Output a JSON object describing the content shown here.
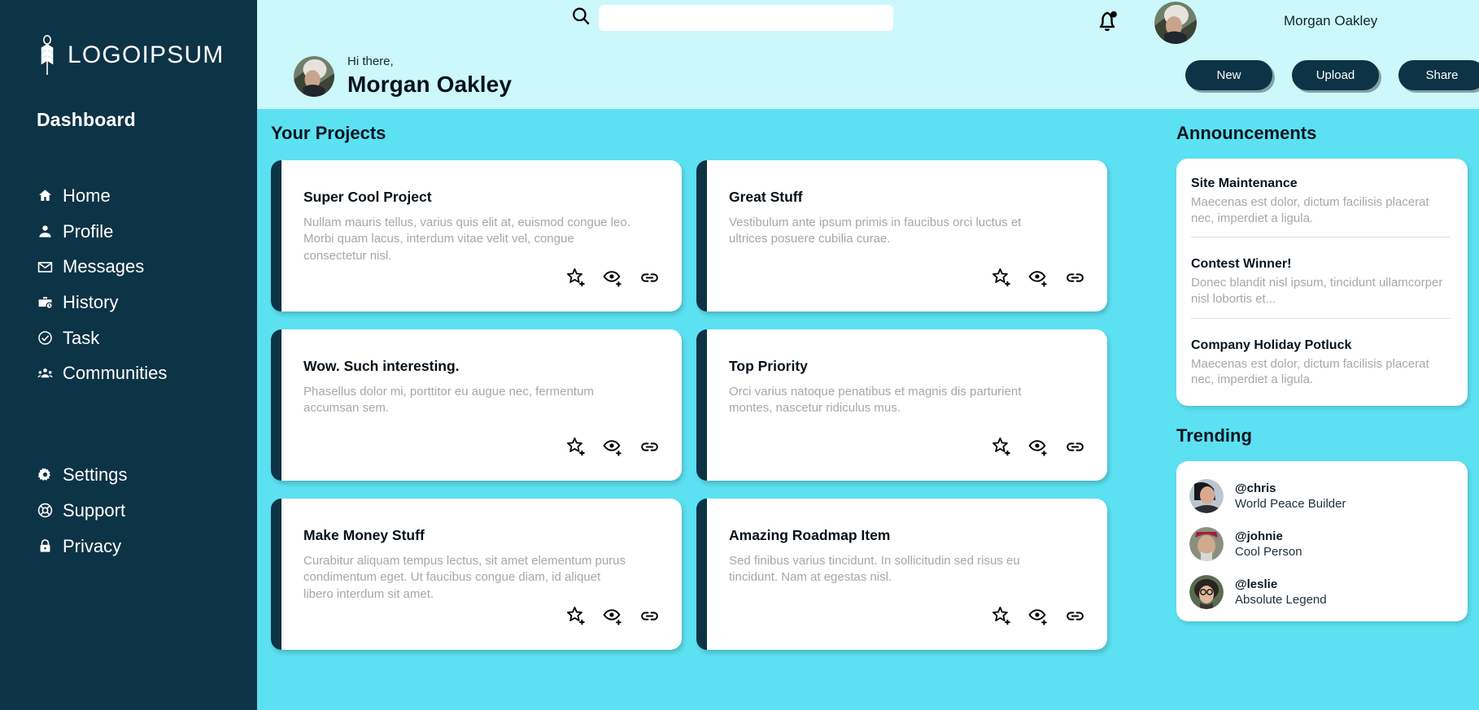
{
  "sidebar": {
    "logo_text": "LOGOIPSUM",
    "dashboard_label": "Dashboard",
    "primary_items": [
      {
        "label": "Home",
        "icon": "home-icon"
      },
      {
        "label": "Profile",
        "icon": "person-icon"
      },
      {
        "label": "Messages",
        "icon": "envelope-icon"
      },
      {
        "label": "History",
        "icon": "briefcase-clock-icon"
      },
      {
        "label": "Task",
        "icon": "check-circle-icon"
      },
      {
        "label": "Communities",
        "icon": "people-group-icon"
      }
    ],
    "secondary_items": [
      {
        "label": "Settings",
        "icon": "gear-icon"
      },
      {
        "label": "Support",
        "icon": "lifebuoy-icon"
      },
      {
        "label": "Privacy",
        "icon": "lock-icon"
      }
    ]
  },
  "topbar": {
    "search_value": "",
    "search_placeholder": "",
    "search_icon": "search-icon",
    "bell_icon": "notification-bell-icon",
    "username": "Morgan Oakley",
    "avatar": "user-avatar"
  },
  "greeting": {
    "hi": "Hi there,",
    "name": "Morgan Oakley",
    "buttons": [
      {
        "label": "New"
      },
      {
        "label": "Upload"
      },
      {
        "label": "Share"
      }
    ]
  },
  "projects": {
    "heading": "Your Projects",
    "card_icons": [
      "star-plus-icon",
      "eye-plus-icon",
      "link-icon"
    ],
    "items": [
      {
        "title": "Super Cool Project",
        "desc": "Nullam mauris tellus, varius quis elit at, euismod congue leo. Morbi quam lacus, interdum vitae velit vel, congue consectetur nisl."
      },
      {
        "title": "Great Stuff",
        "desc": "Vestibulum ante ipsum primis in faucibus orci luctus et ultrices posuere cubilia curae."
      },
      {
        "title": "Wow. Such interesting.",
        "desc": "Phasellus dolor mi, porttitor eu augue nec, fermentum accumsan sem."
      },
      {
        "title": "Top Priority",
        "desc": "Orci varius natoque penatibus et magnis dis parturient montes, nascetur ridiculus mus."
      },
      {
        "title": "Make Money Stuff",
        "desc": "Curabitur aliquam tempus lectus, sit amet elementum purus condimentum eget. Ut faucibus congue diam, id aliquet libero interdum sit amet."
      },
      {
        "title": "Amazing Roadmap Item",
        "desc": "Sed finibus varius tincidunt. In sollicitudin sed risus eu tincidunt. Nam at egestas nisl."
      }
    ]
  },
  "announcements": {
    "heading": "Announcements",
    "items": [
      {
        "title": "Site Maintenance",
        "body": "Maecenas est dolor, dictum facilisis placerat nec, imperdiet a ligula."
      },
      {
        "title": "Contest Winner!",
        "body": "Donec blandit nisl ipsum, tincidunt ullamcorper nisl lobortis et..."
      },
      {
        "title": "Company Holiday Potluck",
        "body": "Maecenas est dolor, dictum facilisis placerat nec, imperdiet a ligula."
      }
    ]
  },
  "trending": {
    "heading": "Trending",
    "items": [
      {
        "handle": "@chris",
        "tagline": "World Peace Builder"
      },
      {
        "handle": "@johnie",
        "tagline": "Cool Person"
      },
      {
        "handle": "@leslie",
        "tagline": "Absolute Legend"
      }
    ]
  },
  "colors": {
    "sidebar_bg": "#0c3346",
    "topbar_bg": "#ccf7fb",
    "main_bg": "#5ce1f2",
    "card_bg": "#ffffff",
    "muted_text": "#a8a8a8"
  }
}
